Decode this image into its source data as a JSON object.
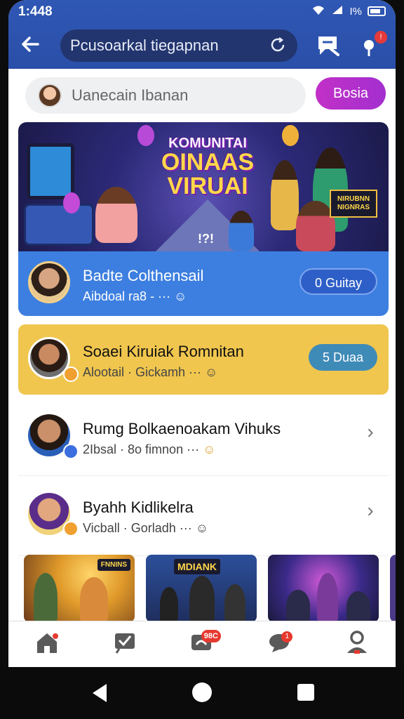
{
  "status_bar": {
    "time": "1:448",
    "battery": "I%"
  },
  "header": {
    "search_query": "Pcusoarkal tiegapnan"
  },
  "compose": {
    "placeholder_text": "Uanecain Ibanan",
    "post_button": "Bosia"
  },
  "banner": {
    "line1": "KOMUNITAI",
    "line2": "OINAAS",
    "line3": "VIRUAI",
    "sign_text": "NIRUBNN NIGNRAS",
    "emoji_marks": "!?!"
  },
  "cards": [
    {
      "name": "Badte Colthensail",
      "meta": "Aibdoal ra8 -  ··· ",
      "action": "0 Guitay",
      "style": "blue"
    },
    {
      "name": "Soaei Kiruiak Romnitan",
      "meta": "Alootail  ·  Gickamh  ··· ",
      "action": "5 Duaa",
      "style": "yellow"
    },
    {
      "name": "Rumg Bolkaenoakam Vihuks",
      "meta": "2Ibsal  ·  8o fimnon  ··· ",
      "style": "white"
    },
    {
      "name": "Byahh Kidlikelra",
      "meta": "Vicball  ·  Gorladh  ··· ",
      "style": "white"
    }
  ],
  "thumbnails": [
    {
      "label": "FNNINS"
    },
    {
      "label": "MDIANK"
    },
    {
      "label": ""
    },
    {
      "label": ""
    }
  ],
  "bottom_nav": {
    "items": [
      {
        "name": "home"
      },
      {
        "name": "tasks"
      },
      {
        "name": "messages",
        "badge": "98C"
      },
      {
        "name": "chat",
        "badge": "1"
      },
      {
        "name": "profile"
      }
    ]
  },
  "colors": {
    "header": "#2f57b4",
    "post_button": "#b82fcb",
    "card_blue": "#3d7fe0",
    "card_yellow": "#f0c64e",
    "badge": "#e6392f"
  }
}
